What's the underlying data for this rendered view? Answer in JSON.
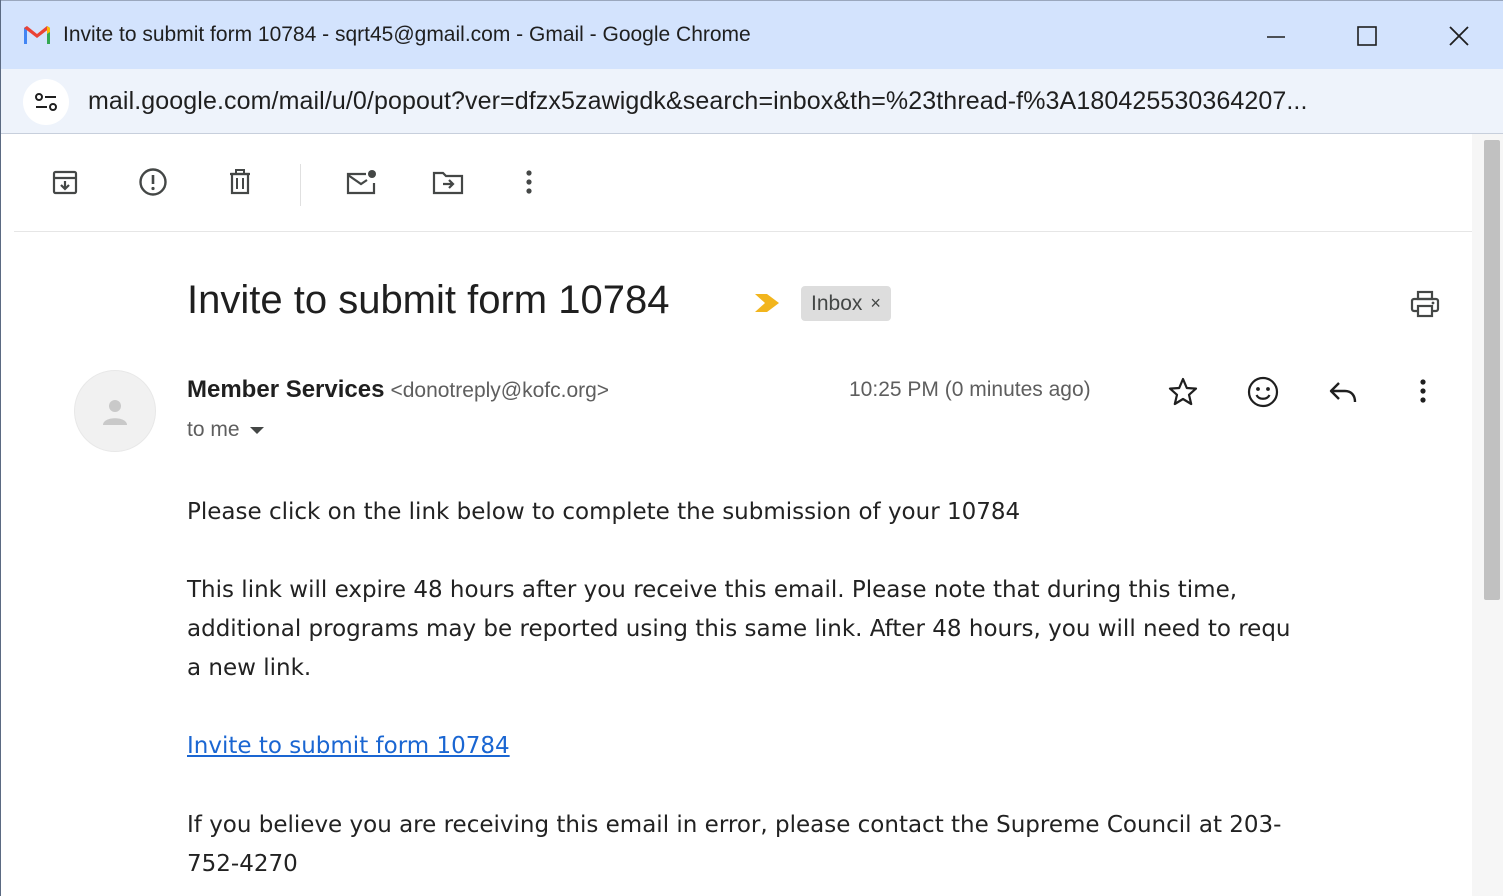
{
  "window": {
    "title": "Invite to submit form 10784 - sqrt45@gmail.com - Gmail - Google Chrome",
    "minimize_glyph": "—",
    "maximize_glyph": "☐",
    "close_glyph": "✕"
  },
  "address_bar": {
    "url": "mail.google.com/mail/u/0/popout?ver=dfzx5zawigdk&search=inbox&th=%23thread-f%3A180425530364207..."
  },
  "toolbar": {
    "icons": [
      "archive-icon",
      "report-spam-icon",
      "delete-icon",
      "mark-unread-icon",
      "move-to-icon",
      "more-icon"
    ]
  },
  "email": {
    "subject": "Invite to submit form 10784",
    "label": "Inbox",
    "label_remove": "×",
    "sender_name": "Member Services",
    "sender_email": "<donotreply@kofc.org>",
    "recipient": "to me",
    "timestamp": "10:25 PM (0 minutes ago)",
    "body": {
      "para1": "Please click on the link below to complete the submission of your 10784",
      "para2_line1": "This link will expire 48 hours after you receive this email. Please note that during this time,",
      "para2_line2": "additional programs may be reported using this same link. After 48 hours, you will need to requ",
      "para2_line3": "a new link.",
      "link_text": "Invite to submit form 10784",
      "para3_line1": "If you believe you are receiving this email in error, please contact the Supreme Council at 203-",
      "para3_line2": "752-4270"
    }
  },
  "colors": {
    "titlebar": "#d3e3fd",
    "link": "#1a66d2",
    "importance_marker": "#f2b51d",
    "label_chip": "#dddddd"
  }
}
